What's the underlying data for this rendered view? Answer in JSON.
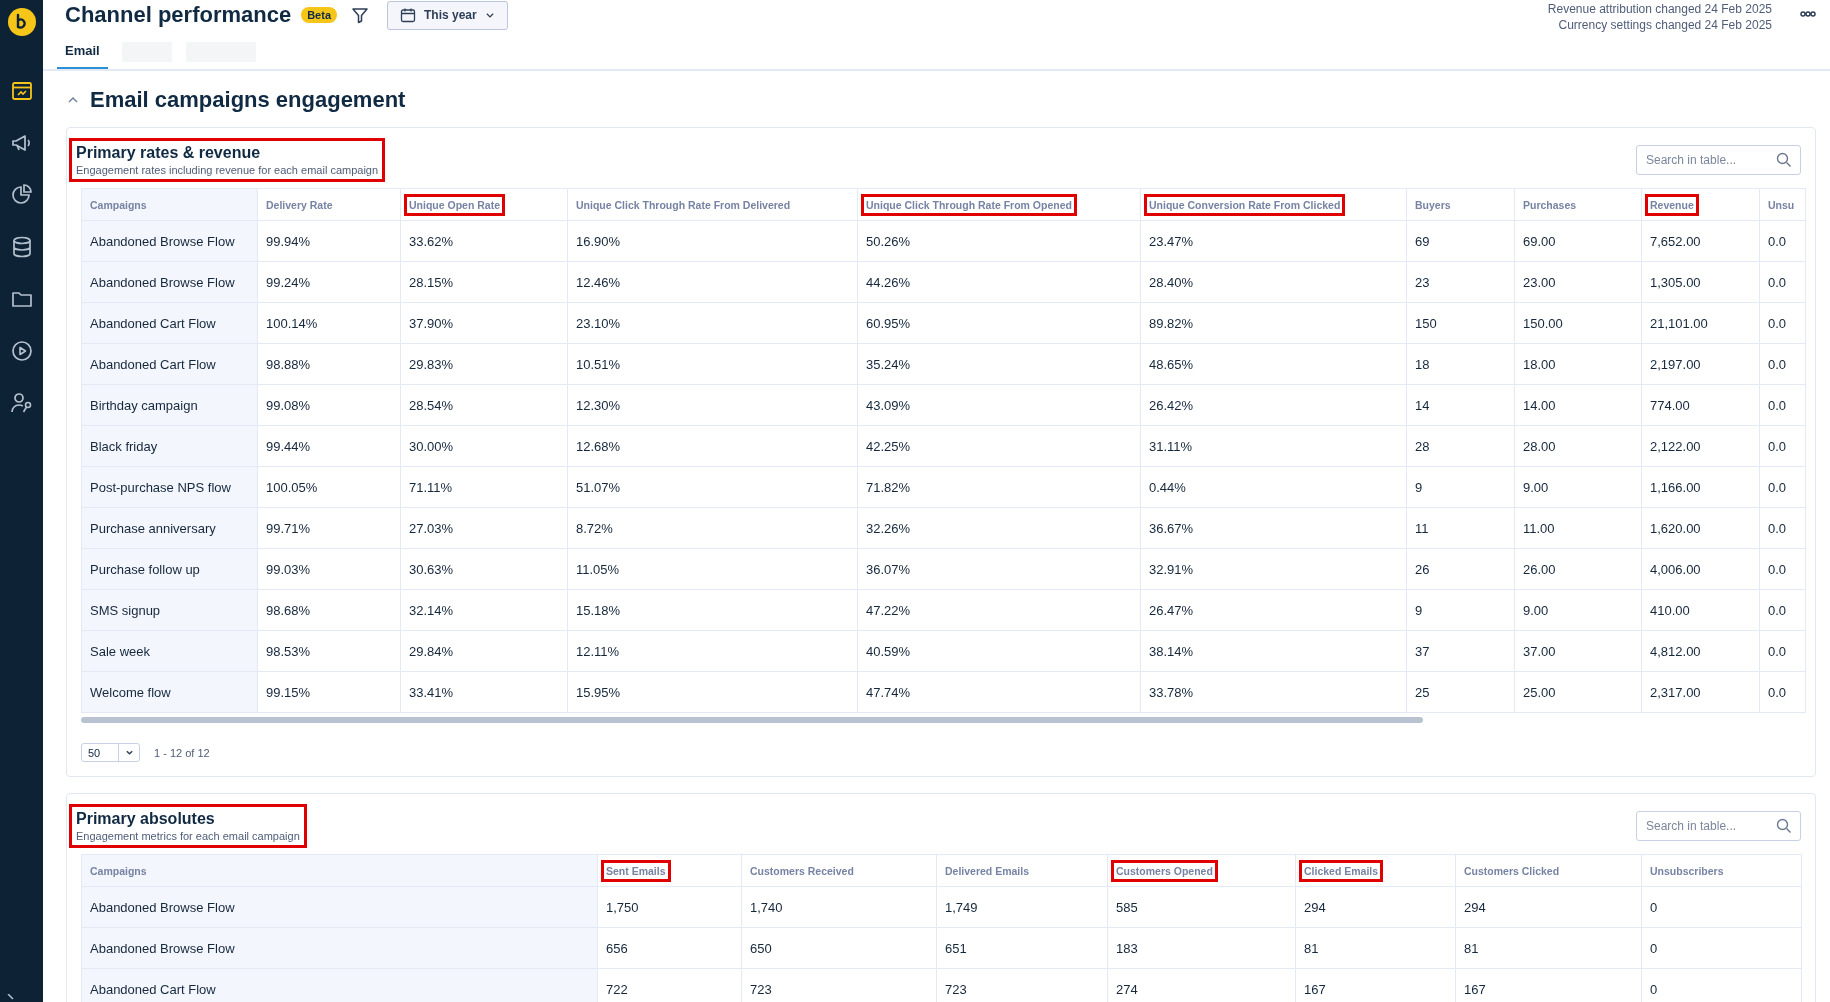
{
  "sidebar": {
    "items": [
      {
        "selected": true
      },
      {
        "selected": false
      },
      {
        "selected": false
      },
      {
        "selected": false
      },
      {
        "selected": false
      },
      {
        "selected": false
      },
      {
        "selected": false
      }
    ]
  },
  "header": {
    "title": "Channel performance",
    "badge": "Beta",
    "date_filter": "This year",
    "notes": [
      "Revenue attribution changed 24 Feb 2025",
      "Currency settings changed 24 Feb 2025"
    ]
  },
  "tabs": [
    {
      "label": "Email",
      "selected": true
    }
  ],
  "section": {
    "title": "Email campaigns engagement",
    "expanded": true
  },
  "cards": [
    {
      "title": "Primary rates & revenue",
      "subtitle": "Engagement rates including revenue for each email campaign",
      "highlighted": true,
      "search": {
        "placeholder": "Search in table..."
      },
      "columns": [
        {
          "label": "Campaigns",
          "highlighted": false
        },
        {
          "label": "Delivery Rate",
          "highlighted": false
        },
        {
          "label": "Unique Open Rate",
          "highlighted": true
        },
        {
          "label": "Unique Click Through Rate From Delivered",
          "highlighted": false
        },
        {
          "label": "Unique Click Through Rate From Opened",
          "highlighted": true
        },
        {
          "label": "Unique Conversion Rate From Clicked",
          "highlighted": true
        },
        {
          "label": "Buyers",
          "highlighted": false
        },
        {
          "label": "Purchases",
          "highlighted": false
        },
        {
          "label": "Revenue",
          "highlighted": true
        },
        {
          "label": "Unsu",
          "highlighted": false
        }
      ],
      "rows": [
        [
          "Abandoned Browse Flow",
          "99.94%",
          "33.62%",
          "16.90%",
          "50.26%",
          "23.47%",
          "69",
          "69.00",
          "7,652.00",
          "0.0"
        ],
        [
          "Abandoned Browse Flow",
          "99.24%",
          "28.15%",
          "12.46%",
          "44.26%",
          "28.40%",
          "23",
          "23.00",
          "1,305.00",
          "0.0"
        ],
        [
          "Abandoned Cart Flow",
          "100.14%",
          "37.90%",
          "23.10%",
          "60.95%",
          "89.82%",
          "150",
          "150.00",
          "21,101.00",
          "0.0"
        ],
        [
          "Abandoned Cart Flow",
          "98.88%",
          "29.83%",
          "10.51%",
          "35.24%",
          "48.65%",
          "18",
          "18.00",
          "2,197.00",
          "0.0"
        ],
        [
          "Birthday campaign",
          "99.08%",
          "28.54%",
          "12.30%",
          "43.09%",
          "26.42%",
          "14",
          "14.00",
          "774.00",
          "0.0"
        ],
        [
          "Black friday",
          "99.44%",
          "30.00%",
          "12.68%",
          "42.25%",
          "31.11%",
          "28",
          "28.00",
          "2,122.00",
          "0.0"
        ],
        [
          "Post-purchase NPS flow",
          "100.05%",
          "71.11%",
          "51.07%",
          "71.82%",
          "0.44%",
          "9",
          "9.00",
          "1,166.00",
          "0.0"
        ],
        [
          "Purchase anniversary",
          "99.71%",
          "27.03%",
          "8.72%",
          "32.26%",
          "36.67%",
          "11",
          "11.00",
          "1,620.00",
          "0.0"
        ],
        [
          "Purchase follow up",
          "99.03%",
          "30.63%",
          "11.05%",
          "36.07%",
          "32.91%",
          "26",
          "26.00",
          "4,006.00",
          "0.0"
        ],
        [
          "SMS signup",
          "98.68%",
          "32.14%",
          "15.18%",
          "47.22%",
          "26.47%",
          "9",
          "9.00",
          "410.00",
          "0.0"
        ],
        [
          "Sale week",
          "98.53%",
          "29.84%",
          "12.11%",
          "40.59%",
          "38.14%",
          "37",
          "37.00",
          "4,812.00",
          "0.0"
        ],
        [
          "Welcome flow",
          "99.15%",
          "33.41%",
          "15.95%",
          "47.74%",
          "33.78%",
          "25",
          "25.00",
          "2,317.00",
          "0.0"
        ]
      ],
      "pager": {
        "page_size": "50",
        "range": "1 - 12 of 12"
      }
    },
    {
      "title": "Primary absolutes",
      "subtitle": "Engagement metrics for each email campaign",
      "highlighted": true,
      "search": {
        "placeholder": "Search in table..."
      },
      "columns": [
        {
          "label": "Campaigns",
          "highlighted": false
        },
        {
          "label": "Sent Emails",
          "highlighted": true
        },
        {
          "label": "Customers Received",
          "highlighted": false
        },
        {
          "label": "Delivered Emails",
          "highlighted": false
        },
        {
          "label": "Customers Opened",
          "highlighted": true
        },
        {
          "label": "Clicked Emails",
          "highlighted": true
        },
        {
          "label": "Customers Clicked",
          "highlighted": false
        },
        {
          "label": "Unsubscribers",
          "highlighted": false
        }
      ],
      "rows": [
        [
          "Abandoned Browse Flow",
          "1,750",
          "1,740",
          "1,749",
          "585",
          "294",
          "294",
          "0"
        ],
        [
          "Abandoned Browse Flow",
          "656",
          "650",
          "651",
          "183",
          "81",
          "81",
          "0"
        ],
        [
          "Abandoned Cart Flow",
          "722",
          "723",
          "723",
          "274",
          "167",
          "167",
          "0"
        ]
      ]
    }
  ]
}
